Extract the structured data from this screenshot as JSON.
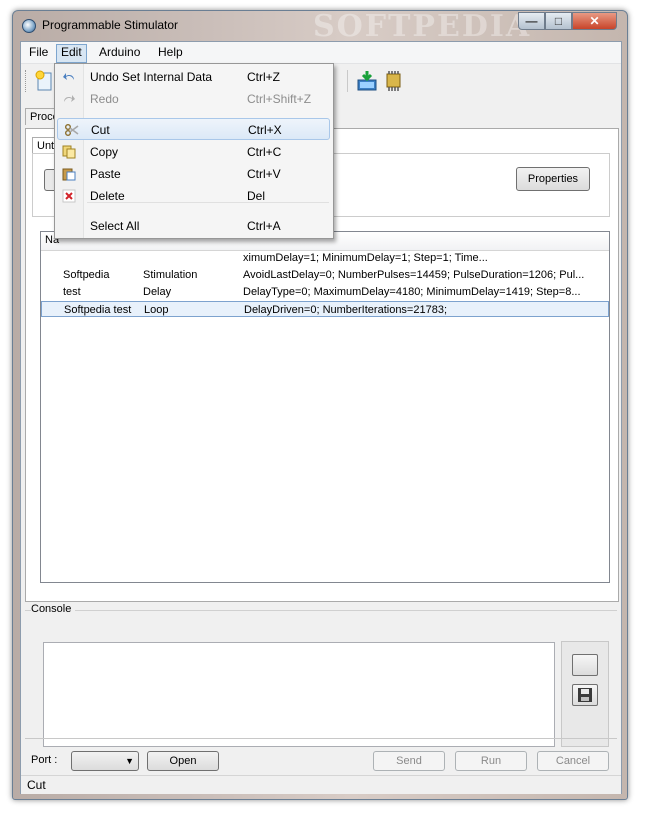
{
  "window": {
    "title": "Programmable Stimulator",
    "watermark": "SOFTPEDIA"
  },
  "menubar": {
    "items": [
      "File",
      "Edit",
      "Arduino",
      "Help"
    ]
  },
  "tabs": {
    "outer_partial": "Proce",
    "inner_partial": "Unti"
  },
  "properties_label": "Properties",
  "list": {
    "header_partial": "Na",
    "rows": [
      {
        "name": "",
        "type": "",
        "params": "ximumDelay=1; MinimumDelay=1; Step=1; Time..."
      },
      {
        "name": "Softpedia",
        "type": "Stimulation",
        "params": "AvoidLastDelay=0; NumberPulses=14459; PulseDuration=1206; Pul..."
      },
      {
        "name": "test",
        "type": "Delay",
        "params": "DelayType=0; MaximumDelay=4180; MinimumDelay=1419; Step=8..."
      },
      {
        "name": "Softpedia test",
        "type": "Loop",
        "params": "DelayDriven=0; NumberIterations=21783;"
      }
    ]
  },
  "console": {
    "label": "Console"
  },
  "bottom": {
    "port_label": "Port :",
    "port_value": "",
    "open_label": "Open",
    "send_label": "Send",
    "run_label": "Run",
    "cancel_label": "Cancel"
  },
  "status": {
    "text": "Cut"
  },
  "edit_menu": {
    "items": [
      {
        "label": "Undo Set Internal Data",
        "shortcut": "Ctrl+Z"
      },
      {
        "label": "Redo",
        "shortcut": "Ctrl+Shift+Z"
      },
      {
        "label": "Cut",
        "shortcut": "Ctrl+X"
      },
      {
        "label": "Copy",
        "shortcut": "Ctrl+C"
      },
      {
        "label": "Paste",
        "shortcut": "Ctrl+V"
      },
      {
        "label": "Delete",
        "shortcut": "Del"
      },
      {
        "label": "Select All",
        "shortcut": "Ctrl+A"
      }
    ]
  }
}
